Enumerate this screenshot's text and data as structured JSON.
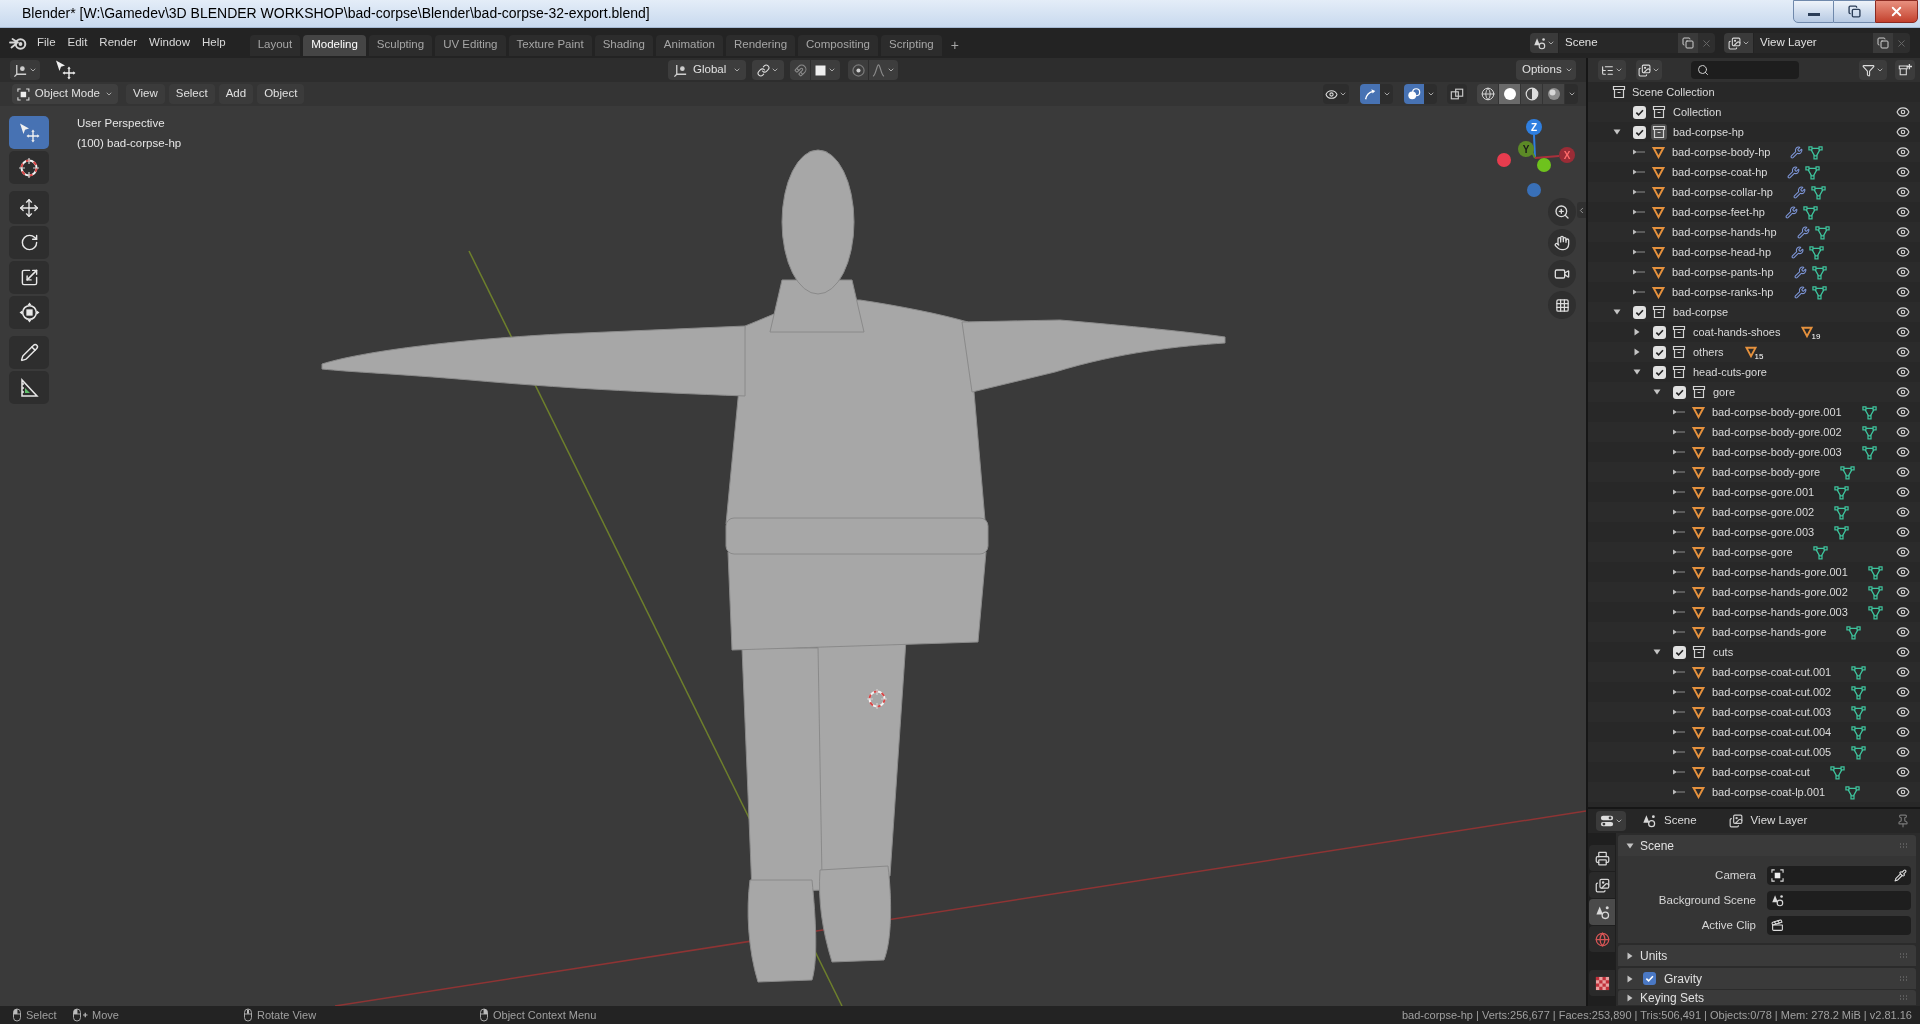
{
  "window": {
    "title": "Blender* [W:\\Gamedev\\3D BLENDER WORKSHOP\\bad-corpse\\Blender\\bad-corpse-32-export.blend]"
  },
  "menu": [
    "File",
    "Edit",
    "Render",
    "Window",
    "Help"
  ],
  "workspaces": [
    {
      "label": "Layout",
      "selected": false
    },
    {
      "label": "Modeling",
      "selected": true
    },
    {
      "label": "Sculpting",
      "selected": false
    },
    {
      "label": "UV Editing",
      "selected": false
    },
    {
      "label": "Texture Paint",
      "selected": false
    },
    {
      "label": "Shading",
      "selected": false
    },
    {
      "label": "Animation",
      "selected": false
    },
    {
      "label": "Rendering",
      "selected": false
    },
    {
      "label": "Compositing",
      "selected": false
    },
    {
      "label": "Scripting",
      "selected": false
    }
  ],
  "add_workspace": "+",
  "scene_selector": {
    "scene": "Scene",
    "view_layer": "View Layer"
  },
  "viewport": {
    "transform_orientation": "Global",
    "options": "Options",
    "mode": "Object Mode",
    "menus": [
      "View",
      "Select",
      "Add",
      "Object"
    ],
    "gizmos_on": true,
    "overlays_on": true,
    "xray_on": false,
    "shading": [
      {
        "kind": "wireframe",
        "selected": false
      },
      {
        "kind": "solid",
        "selected": true
      },
      {
        "kind": "material",
        "selected": false
      },
      {
        "kind": "rendered",
        "selected": false
      }
    ],
    "tool_groups": [
      [
        {
          "kind": "select",
          "selected": true
        },
        {
          "kind": "cursor",
          "selected": false
        }
      ],
      [
        {
          "kind": "move",
          "selected": false
        },
        {
          "kind": "rotate",
          "selected": false
        },
        {
          "kind": "scale",
          "selected": false
        },
        {
          "kind": "transform",
          "selected": false
        }
      ],
      [
        {
          "kind": "annotate",
          "selected": false
        },
        {
          "kind": "measure",
          "selected": false
        }
      ]
    ],
    "info": [
      "User Perspective",
      "(100) bad-corpse-hp"
    ],
    "gizmo_axes": [
      "X",
      "Y",
      "Z"
    ]
  },
  "outliner": {
    "items": [
      {
        "kind": "scene_collection",
        "name": "Scene Collection",
        "active": false,
        "children": [
          {
            "kind": "collection",
            "name": "Collection",
            "checked": true,
            "active": false,
            "visible": true
          },
          {
            "kind": "collection",
            "name": "bad-corpse-hp",
            "checked": true,
            "expanded": true,
            "active": true,
            "visible": true,
            "children": [
              {
                "kind": "object",
                "name": "bad-corpse-body-hp",
                "expanded": false,
                "modifier": true,
                "visible": true
              },
              {
                "kind": "object",
                "name": "bad-corpse-coat-hp",
                "expanded": false,
                "modifier": true,
                "visible": true
              },
              {
                "kind": "object",
                "name": "bad-corpse-collar-hp",
                "expanded": false,
                "modifier": true,
                "visible": true
              },
              {
                "kind": "object",
                "name": "bad-corpse-feet-hp",
                "expanded": false,
                "modifier": true,
                "visible": true
              },
              {
                "kind": "object",
                "name": "bad-corpse-hands-hp",
                "expanded": false,
                "modifier": true,
                "visible": true
              },
              {
                "kind": "object",
                "name": "bad-corpse-head-hp",
                "expanded": false,
                "modifier": true,
                "visible": true
              },
              {
                "kind": "object",
                "name": "bad-corpse-pants-hp",
                "expanded": false,
                "modifier": true,
                "visible": true
              },
              {
                "kind": "object",
                "name": "bad-corpse-ranks-hp",
                "expanded": false,
                "modifier": true,
                "visible": true
              }
            ]
          },
          {
            "kind": "collection",
            "name": "bad-corpse",
            "checked": true,
            "expanded": true,
            "active": false,
            "visible": true,
            "children": [
              {
                "kind": "collection",
                "name": "coat-hands-shoes",
                "checked": true,
                "expanded": false,
                "active": false,
                "child_count": "19",
                "visible": true
              },
              {
                "kind": "collection",
                "name": "others",
                "checked": true,
                "expanded": false,
                "active": false,
                "child_count": "15",
                "visible": true
              },
              {
                "kind": "collection",
                "name": "head-cuts-gore",
                "checked": true,
                "expanded": true,
                "active": false,
                "visible": true,
                "children": [
                  {
                    "kind": "collection",
                    "name": "gore",
                    "checked": true,
                    "expanded": true,
                    "active": false,
                    "visible": true,
                    "children": [
                      {
                        "kind": "object",
                        "name": "bad-corpse-body-gore.001",
                        "expanded": false,
                        "modifier": false,
                        "visible": true
                      },
                      {
                        "kind": "object",
                        "name": "bad-corpse-body-gore.002",
                        "expanded": false,
                        "modifier": false,
                        "visible": true
                      },
                      {
                        "kind": "object",
                        "name": "bad-corpse-body-gore.003",
                        "expanded": false,
                        "modifier": false,
                        "visible": true
                      },
                      {
                        "kind": "object",
                        "name": "bad-corpse-body-gore",
                        "expanded": false,
                        "modifier": false,
                        "visible": true
                      },
                      {
                        "kind": "object",
                        "name": "bad-corpse-gore.001",
                        "expanded": false,
                        "modifier": false,
                        "visible": true
                      },
                      {
                        "kind": "object",
                        "name": "bad-corpse-gore.002",
                        "expanded": false,
                        "modifier": false,
                        "visible": true
                      },
                      {
                        "kind": "object",
                        "name": "bad-corpse-gore.003",
                        "expanded": false,
                        "modifier": false,
                        "visible": true
                      },
                      {
                        "kind": "object",
                        "name": "bad-corpse-gore",
                        "expanded": false,
                        "modifier": false,
                        "visible": true
                      },
                      {
                        "kind": "object",
                        "name": "bad-corpse-hands-gore.001",
                        "expanded": false,
                        "modifier": false,
                        "visible": true
                      },
                      {
                        "kind": "object",
                        "name": "bad-corpse-hands-gore.002",
                        "expanded": false,
                        "modifier": false,
                        "visible": true
                      },
                      {
                        "kind": "object",
                        "name": "bad-corpse-hands-gore.003",
                        "expanded": false,
                        "modifier": false,
                        "visible": true
                      },
                      {
                        "kind": "object",
                        "name": "bad-corpse-hands-gore",
                        "expanded": false,
                        "modifier": false,
                        "visible": true
                      }
                    ]
                  },
                  {
                    "kind": "collection",
                    "name": "cuts",
                    "checked": true,
                    "expanded": true,
                    "active": false,
                    "visible": true,
                    "children": [
                      {
                        "kind": "object",
                        "name": "bad-corpse-coat-cut.001",
                        "expanded": false,
                        "modifier": false,
                        "visible": true
                      },
                      {
                        "kind": "object",
                        "name": "bad-corpse-coat-cut.002",
                        "expanded": false,
                        "modifier": false,
                        "visible": true
                      },
                      {
                        "kind": "object",
                        "name": "bad-corpse-coat-cut.003",
                        "expanded": false,
                        "modifier": false,
                        "visible": true
                      },
                      {
                        "kind": "object",
                        "name": "bad-corpse-coat-cut.004",
                        "expanded": false,
                        "modifier": false,
                        "visible": true
                      },
                      {
                        "kind": "object",
                        "name": "bad-corpse-coat-cut.005",
                        "expanded": false,
                        "modifier": false,
                        "visible": true
                      },
                      {
                        "kind": "object",
                        "name": "bad-corpse-coat-cut",
                        "expanded": false,
                        "modifier": false,
                        "visible": true
                      },
                      {
                        "kind": "object",
                        "name": "bad-corpse-coat-lp.001",
                        "expanded": false,
                        "modifier": false,
                        "visible": true
                      }
                    ]
                  }
                ]
              }
            ]
          }
        ]
      }
    ]
  },
  "properties": {
    "context": [
      {
        "kind": "scene",
        "label": "Scene"
      },
      {
        "kind": "view_layer",
        "label": "View Layer"
      }
    ],
    "tab_groups": [
      [
        {
          "kind": "render",
          "selected": false
        },
        {
          "kind": "view_layer",
          "selected": false
        },
        {
          "kind": "scene",
          "selected": true
        },
        {
          "kind": "world",
          "selected": false
        }
      ],
      [
        {
          "kind": "texture",
          "selected": false
        }
      ]
    ],
    "panels": [
      {
        "title": "Scene",
        "expanded": true,
        "fields": [
          {
            "kind": "camera",
            "label": "Camera"
          },
          {
            "kind": "scene",
            "label": "Background Scene"
          },
          {
            "kind": "clip",
            "label": "Active Clip"
          }
        ]
      },
      {
        "title": "Units",
        "expanded": false
      },
      {
        "title": "Gravity",
        "expanded": false,
        "checked": true
      },
      {
        "title": "Keying Sets",
        "expanded": false
      }
    ]
  },
  "status_bar": {
    "hints": [
      {
        "kind": "left",
        "label": "Select"
      },
      {
        "kind": "drag",
        "label": "Move"
      },
      {
        "kind": "middle",
        "label": "Rotate View"
      },
      {
        "kind": "right",
        "label": "Object Context Menu"
      }
    ],
    "stats": "bad-corpse-hp | Verts:256,677 | Faces:253,890 | Tris:506,491 | Objects:0/78 | Mem: 278.2 MiB | v2.81.16"
  }
}
